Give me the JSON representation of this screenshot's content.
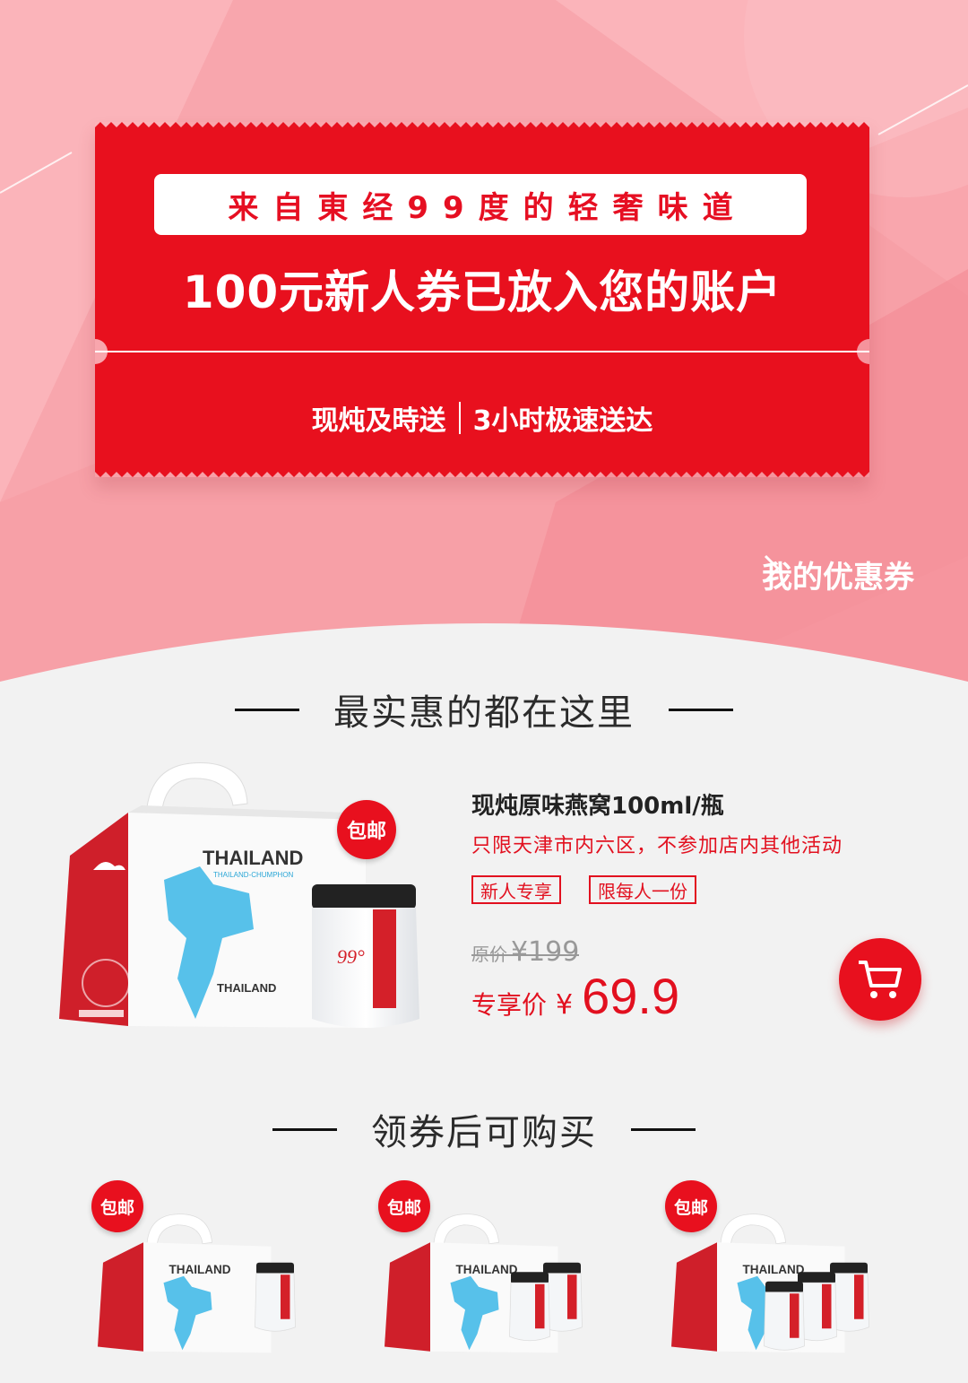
{
  "banner": {
    "slogan": "来自東经99度的轻奢味道",
    "coupon_title": "100元新人券已放入您的账户",
    "service_left": "现炖及時送",
    "service_right": "3小时极速送达",
    "my_coupon_label": "我的优惠券"
  },
  "sections": {
    "best_deals_title": "最实惠的都在这里",
    "after_coupon_title": "领券后可购买"
  },
  "featured_product": {
    "badge": "包邮",
    "name": "现炖原味燕窝100ml/瓶",
    "note": "只限天津市内六区，不参加店内其他活动",
    "tags": [
      "新人专享",
      "限每人一份"
    ],
    "original_price_label": "原价",
    "original_price": "¥199",
    "price_label": "专享价",
    "currency": "¥",
    "price": "69.9",
    "box_brand": "THAILAND",
    "box_sub": "THAILAND-CHUMPHON",
    "box_bottom": "THAILAND"
  },
  "product_thumbs": [
    {
      "badge": "包邮",
      "brand": "THAILAND",
      "jars": 1
    },
    {
      "badge": "包邮",
      "brand": "THAILAND",
      "jars": 2
    },
    {
      "badge": "包邮",
      "brand": "THAILAND",
      "jars": 3
    }
  ],
  "colors": {
    "brand_red": "#e60f22",
    "hero_pink": "#f9a6ad",
    "background": "#f2f2f2"
  },
  "icons": [
    "chevron-right-icon",
    "cart-icon"
  ]
}
